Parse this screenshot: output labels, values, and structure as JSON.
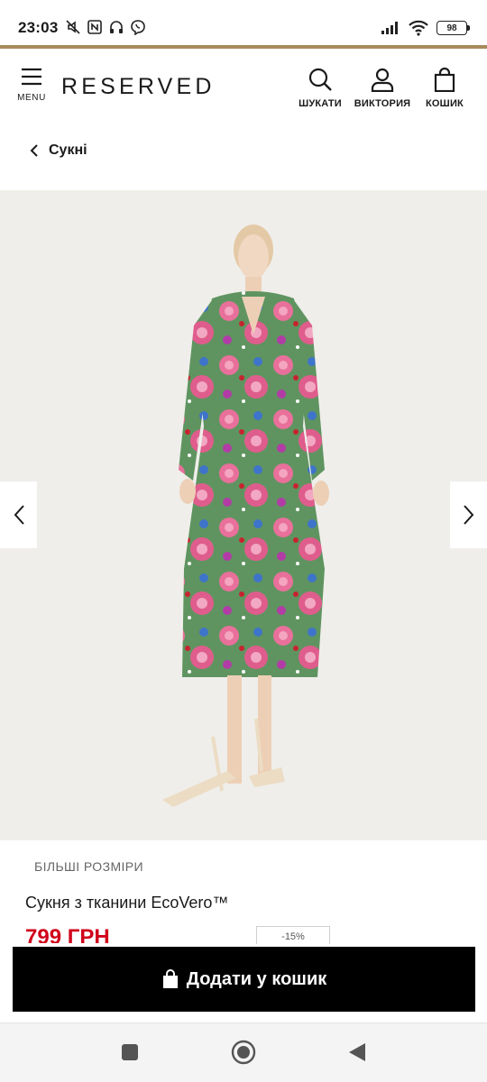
{
  "status_bar": {
    "time": "23:03",
    "battery": "98",
    "icons": [
      "mute-icon",
      "nfc-icon",
      "headset-icon",
      "viber-icon",
      "signal-icon",
      "wifi-icon",
      "battery-icon"
    ]
  },
  "header": {
    "menu_label": "MENU",
    "logo": "RESERVED",
    "search_label": "ШУКАТИ",
    "account_label": "ВИКТОРИЯ",
    "cart_label": "КОШИК"
  },
  "breadcrumb": {
    "label": "Сукні"
  },
  "product": {
    "category": "БІЛЬШІ РОЗМІРИ",
    "title": "Сукня з тканини EcoVero™",
    "price": "799 ГРН",
    "badge": "-15%",
    "price_color": "#d0021b"
  },
  "actions": {
    "add_to_cart": "Додати у кошик"
  },
  "colors": {
    "accent_line": "#a88a5a",
    "button_bg": "#000000"
  }
}
